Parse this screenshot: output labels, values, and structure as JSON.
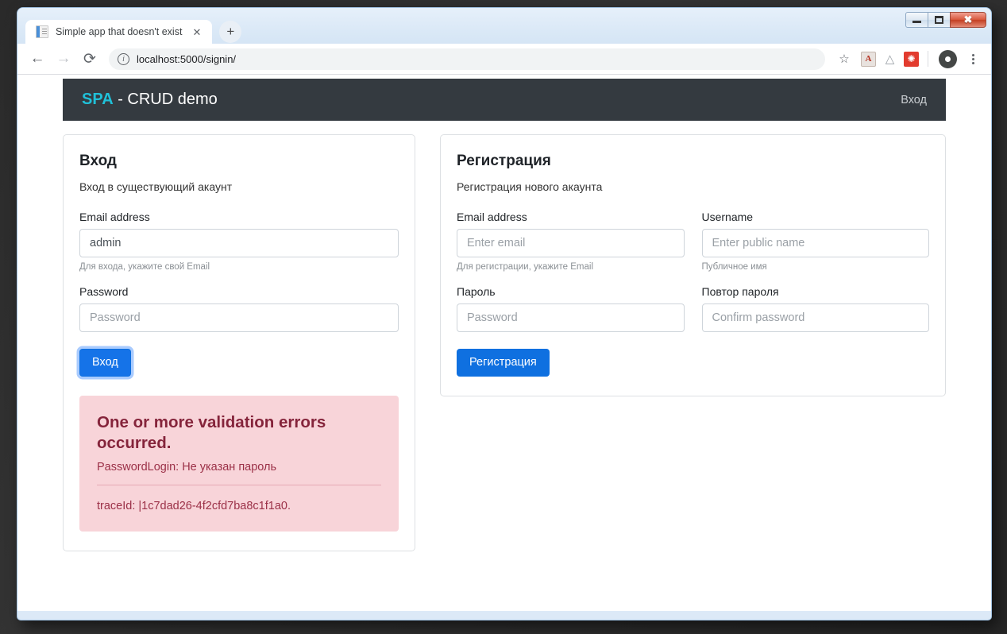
{
  "window": {
    "controls": {
      "minimize": "minimize",
      "maximize": "maximize",
      "close": "close"
    }
  },
  "browser": {
    "tab": {
      "title": "Simple app that doesn't exist",
      "close_label": "✕",
      "favicon": "document-icon"
    },
    "new_tab_label": "+",
    "back_label": "←",
    "forward_label": "→",
    "reload_label": "⟳",
    "info_label": "i",
    "url": "localhost:5000/signin/",
    "star_label": "☆",
    "extensions": [
      {
        "name": "pdf-extension-icon",
        "glyph": "A"
      },
      {
        "name": "drive-extension-icon",
        "glyph": "△"
      },
      {
        "name": "red-extension-icon",
        "glyph": "✺"
      }
    ]
  },
  "page": {
    "navbar": {
      "brand_accent": "SPA",
      "brand_rest": " - CRUD demo",
      "link": "Вход"
    },
    "login_card": {
      "title": "Вход",
      "subtitle": "Вход в существующий акаунт",
      "email_label": "Email address",
      "email_value": "admin",
      "email_help": "Для входа, укажите свой Email",
      "password_label": "Password",
      "password_placeholder": "Password",
      "submit_label": "Вход"
    },
    "alert": {
      "title": "One or more validation errors occurred.",
      "item": "PasswordLogin: Не указан пароль",
      "trace": "traceId: |1c7dad26-4f2cfd7ba8c1f1a0."
    },
    "register_card": {
      "title": "Регистрация",
      "subtitle": "Регистрация нового акаунта",
      "email_label": "Email address",
      "email_placeholder": "Enter email",
      "email_help": "Для регистрации, укажите Email",
      "username_label": "Username",
      "username_placeholder": "Enter public name",
      "username_help": "Публичное имя",
      "password_label": "Пароль",
      "password_placeholder": "Password",
      "confirm_label": "Повтор пароля",
      "confirm_placeholder": "Confirm password",
      "submit_label": "Регистрация"
    }
  },
  "colors": {
    "navbar_bg": "#343a40",
    "brand_accent": "#20c0d8",
    "primary_button": "#0f70e0",
    "alert_bg": "#f8d4d9",
    "alert_title_text": "#85243b",
    "alert_body_text": "#9b3047"
  }
}
